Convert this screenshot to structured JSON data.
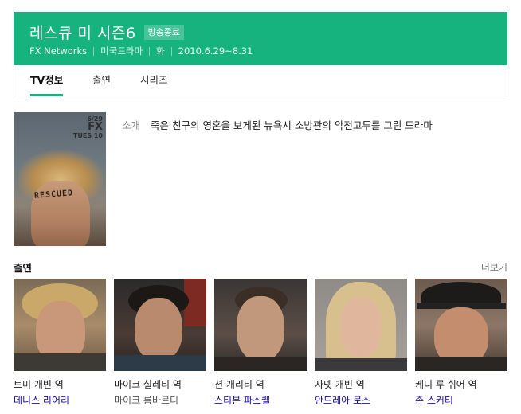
{
  "header": {
    "title": "레스큐 미 시즌6",
    "badge": "방송종료",
    "meta": [
      "FX Networks",
      "미국드라마",
      "화",
      "2010.6.29~8.31"
    ],
    "colors": {
      "brand": "#17b37e"
    }
  },
  "tabs": [
    {
      "label": "TV정보",
      "active": true
    },
    {
      "label": "출연",
      "active": false
    },
    {
      "label": "시리즈",
      "active": false
    }
  ],
  "poster": {
    "logo_date": "6/29",
    "logo_brand": "FX",
    "logo_sub": "TUES 10",
    "forehead_text": "RESCUED"
  },
  "intro": {
    "label": "소개",
    "text": "죽은 친구의 영혼을 보게된 뉴욕시 소방관의 악전고투를 그린 드라마"
  },
  "cast_section": {
    "heading": "출연",
    "more": "더보기",
    "members": [
      {
        "role": "토미 개빈 역",
        "name": "데니스 리어리",
        "linked": true
      },
      {
        "role": "마이크 실레티 역",
        "name": "마이크 롬바르디",
        "linked": false
      },
      {
        "role": "션 개리티 역",
        "name": "스티븐 파스퀠",
        "linked": true
      },
      {
        "role": "자넷 개빈 역",
        "name": "안드레아 로스",
        "linked": true
      },
      {
        "role": "케니 루 쉬어 역",
        "name": "존 스커티",
        "linked": true
      }
    ]
  }
}
